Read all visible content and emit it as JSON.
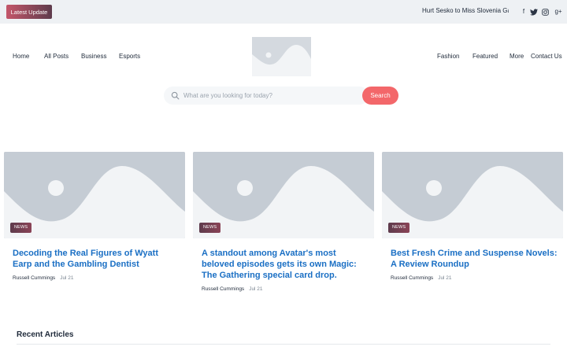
{
  "topbar": {
    "latest_label": "Latest Update",
    "ticker_text": "Hurt Sesko to Miss Slovenia Game",
    "social_icons": [
      "facebook-icon",
      "twitter-icon",
      "instagram-icon",
      "google-plus-icon"
    ],
    "social_glyphs": {
      "facebook": "f",
      "googleplus": "g+"
    }
  },
  "nav": {
    "left": [
      "Home",
      "All Posts",
      "Business",
      "Esports"
    ],
    "right": [
      "Fashion",
      "Featured",
      "More",
      "Contact Us"
    ]
  },
  "search": {
    "placeholder": "What are you looking for today?",
    "button_label": "Search"
  },
  "cards": [
    {
      "badge": "NEWS",
      "title": "Decoding the Real Figures of Wyatt Earp and the Gambling Dentist",
      "author": "Russell Cummings",
      "date": "Jul 21"
    },
    {
      "badge": "NEWS",
      "title": "A standout among Avatar's most beloved episodes gets its own Magic: The Gathering special card drop.",
      "author": "Russell Cummings",
      "date": "Jul 21"
    },
    {
      "badge": "NEWS",
      "title": "Best Fresh Crime and Suspense Novels: A Review Roundup",
      "author": "Russell Cummings",
      "date": "Jul 21"
    }
  ],
  "recent": {
    "heading": "Recent Articles"
  },
  "colors": {
    "accent": "#f3676a",
    "link": "#1a6fc4",
    "placeholder_bg": "#c5ccd4",
    "topbar_bg": "#eef1f4"
  }
}
